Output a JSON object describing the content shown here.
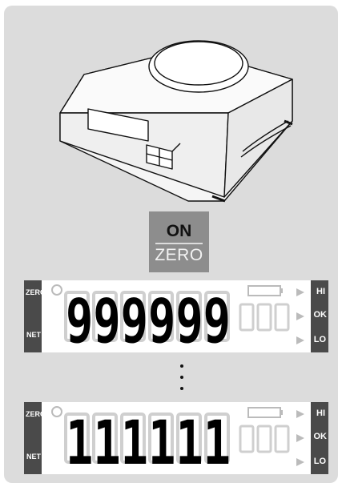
{
  "key": {
    "on": "ON",
    "zero": "ZERO"
  },
  "displays": [
    {
      "zero": "ZERO",
      "net": "NET",
      "hi": "HI",
      "ok": "OK",
      "lo": "LO",
      "digits": "999999"
    },
    {
      "zero": "ZERO",
      "net": "NET",
      "hi": "HI",
      "ok": "OK",
      "lo": "LO",
      "digits": "111111"
    }
  ],
  "ellipsis": ": :"
}
